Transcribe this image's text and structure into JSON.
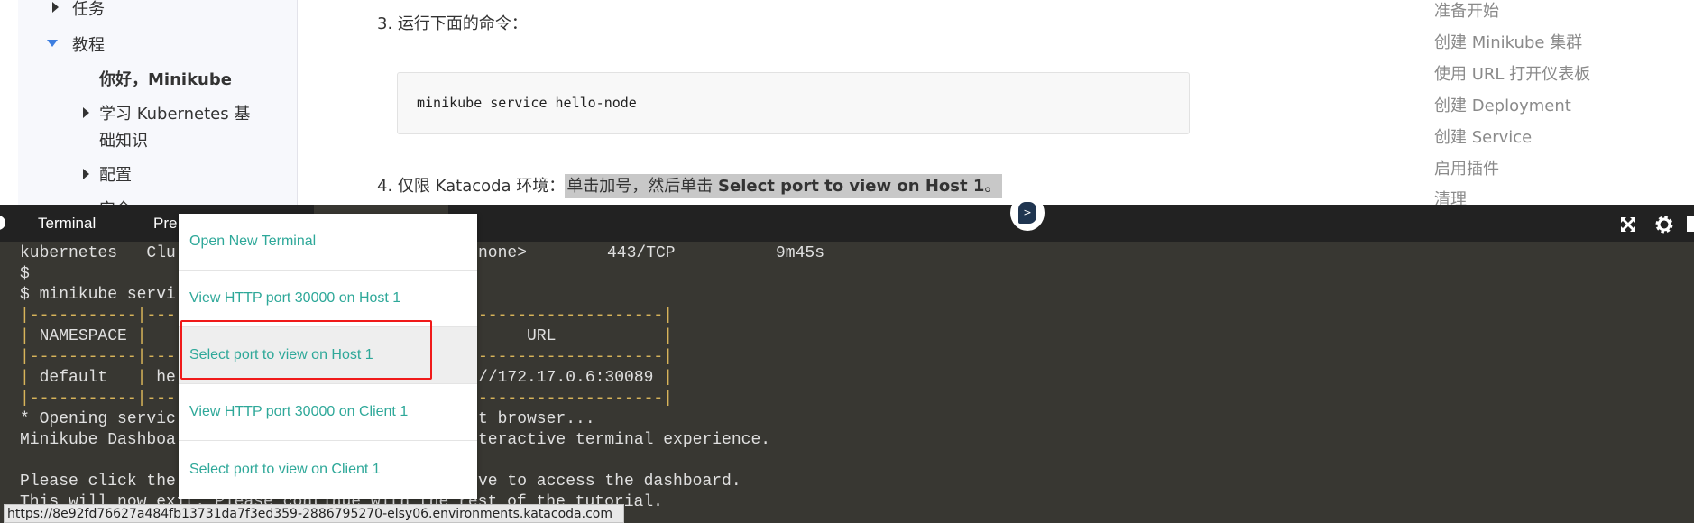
{
  "sidebar": {
    "items": [
      "任务",
      "教程",
      "你好，Minikube",
      "学习 Kubernetes 基",
      "础知识",
      "配置",
      "安全"
    ]
  },
  "main": {
    "step3": "3. 运行下面的命令：",
    "code": "minikube service hello-node",
    "step4_prefix": "4. 仅限 Katacoda 环境：",
    "step4_hl": "单击加号，然后单击 ",
    "step4_bold": "Select port to view on Host 1",
    "step4_end": "。"
  },
  "toc": [
    "准备开始",
    "创建 Minikube 集群",
    "使用 URL 打开仪表板",
    "创建 Deployment",
    "创建 Service",
    "启用插件",
    "清理"
  ],
  "tabs": {
    "terminal": "Terminal",
    "preview": "Pre"
  },
  "terminal": {
    "left": [
      "kubernetes   Clu",
      "$",
      "$ minikube servi",
      "|-----------|---",
      "| NAMESPACE |",
      "|-----------|---",
      "| default   | he",
      "|-----------|---",
      "* Opening servic",
      "Minikube Dashboa",
      "",
      "Please click the",
      "This will now exit. Please continue with the rest of the tutorial."
    ],
    "right": [
      "none>",
      "",
      "",
      "-------------------|",
      "     URL           |",
      "-------------------|",
      "//172.17.0.6:30089 |",
      "-------------------|",
      "t browser...",
      "teractive terminal experience.",
      "",
      "ve to access the dashboard.",
      ""
    ],
    "col_port": "443/TCP",
    "col_age": "9m45s"
  },
  "menu": {
    "items": [
      "Open New Terminal",
      "View HTTP port 30000 on Host 1",
      "Select port to view on Host 1",
      "View HTTP port 30000 on Client 1",
      "Select port to view on Client 1"
    ],
    "highlighted": 2
  },
  "status_url": "https://8e92fd76627a484fb13731da7f3ed359-2886795270-elsy06.environments.katacoda.com",
  "colors": {
    "accent": "#2ea899",
    "highlight_box": "#f01a1a",
    "terminal_bg": "#383732",
    "tabbar_bg": "#222222"
  }
}
